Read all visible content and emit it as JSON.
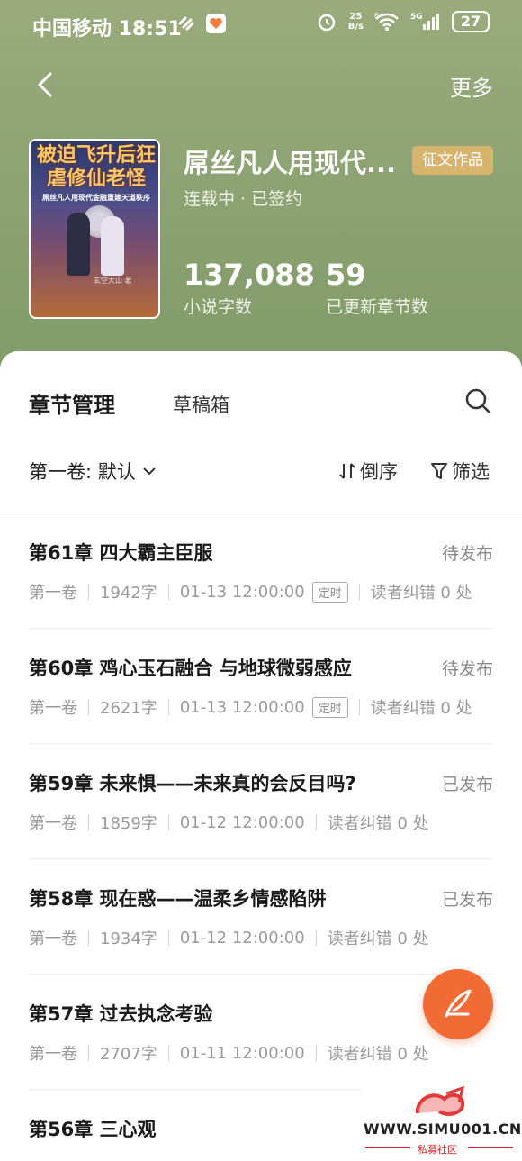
{
  "status_bar": {
    "carrier_time": "中国移动 18:51",
    "net_speed_value": "25",
    "net_speed_unit": "B/s",
    "wifi_badge": "6",
    "signal_label": "5G",
    "battery": "27"
  },
  "nav": {
    "more_label": "更多"
  },
  "book": {
    "cover_title": "被迫飞升后狂虐修仙老怪",
    "cover_subtitle": "屌丝凡人用现代金融重建天道秩序",
    "cover_author": "玄空大山 著",
    "title": "屌丝凡人用现代...",
    "tag": "征文作品",
    "status": "连载中 · 已签约",
    "word_count": "137,088",
    "word_count_label": "小说字数",
    "chapter_count": "59",
    "chapter_count_label": "已更新章节数"
  },
  "tabs": {
    "active": "章节管理",
    "draft": "草稿箱"
  },
  "filters": {
    "volume": "第一卷: 默认",
    "sort": "倒序",
    "filter": "筛选"
  },
  "chapters": [
    {
      "title": "第61章 四大霸主臣服",
      "status": "待发布",
      "volume": "第一卷",
      "words": "1942字",
      "time": "01-13 12:00:00",
      "timed": "定时",
      "errata": "读者纠错 0 处"
    },
    {
      "title": "第60章 鸡心玉石融合 与地球微弱感应",
      "status": "待发布",
      "volume": "第一卷",
      "words": "2621字",
      "time": "01-13 12:00:00",
      "timed": "定时",
      "errata": "读者纠错 0 处"
    },
    {
      "title": "第59章 未来惧——未来真的会反目吗?",
      "status": "已发布",
      "volume": "第一卷",
      "words": "1859字",
      "time": "01-12 12:00:00",
      "timed": "",
      "errata": "读者纠错 0 处"
    },
    {
      "title": "第58章 现在惑——温柔乡情感陷阱",
      "status": "已发布",
      "volume": "第一卷",
      "words": "1934字",
      "time": "01-12 12:00:00",
      "timed": "",
      "errata": "读者纠错 0 处"
    },
    {
      "title": "第57章 过去执念考验",
      "status": "",
      "volume": "第一卷",
      "words": "2707字",
      "time": "01-11 12:00:00",
      "timed": "",
      "errata": "读者纠错 0 处"
    },
    {
      "title": "第56章 三心观",
      "status": "",
      "volume": "",
      "words": "",
      "time": "",
      "timed": "",
      "errata": ""
    }
  ],
  "watermark": {
    "site": "WWW.SIMU001.CN",
    "label": "私募社区"
  },
  "colors": {
    "accent": "#f26a34",
    "header": "#8fa474",
    "tag": "#d6b46e"
  }
}
